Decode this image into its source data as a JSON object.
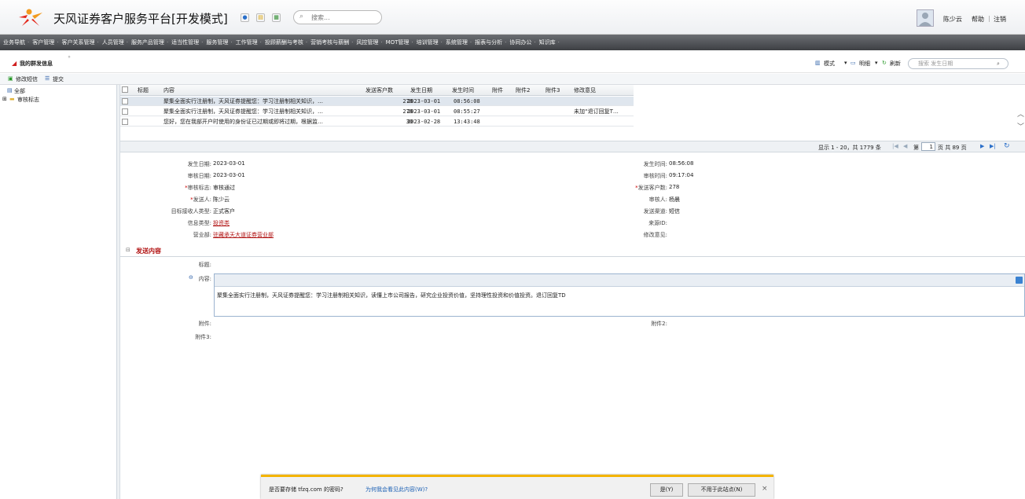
{
  "header": {
    "title": "天风证券客户服务平台[开发模式]",
    "search_placeholder": "搜索...",
    "user_name": "陈少云",
    "help": "帮助",
    "logout": "注销"
  },
  "menu": [
    "业务导航",
    "客户管理",
    "客户关系管理",
    "人员管理",
    "服务产品管理",
    "适当性管理",
    "服务管理",
    "工作管理",
    "投顾薪酬与考核",
    "营销考核与薪酬",
    "风控管理",
    "MOT管理",
    "培训管理",
    "系统管理",
    "报表与分析",
    "协同办公",
    "知识库"
  ],
  "page_tab": "我的群发信息",
  "toolbar": {
    "edit_sms": "修改短信",
    "submit": "提交",
    "mode": "模式",
    "detail": "明细",
    "refresh": "刷新",
    "search_placeholder": "搜索 发生日期"
  },
  "tree": {
    "all": "全部",
    "audit_flag": "审核标志"
  },
  "grid": {
    "headers": [
      "标题",
      "内容",
      "发送客户数",
      "发生日期",
      "发生时间",
      "附件",
      "附件2",
      "附件3",
      "修改意见"
    ],
    "rows": [
      {
        "content": "聚集全面实行注册制，天风证券提醒您：学习注册制相关知识，…",
        "count": "278",
        "date": "2023-03-01",
        "time": "08:56:08",
        "remark": ""
      },
      {
        "content": "聚集全面实行注册制，天风证券提醒您：学习注册制相关知识，…",
        "count": "278",
        "date": "2023-03-01",
        "time": "08:55:27",
        "remark": "未加“退订回复T…"
      },
      {
        "content": "您好，您在我部开户时使用的身份证已过期或即将过期，根据监…",
        "count": "30",
        "date": "2023-02-28",
        "time": "13:43:48",
        "remark": ""
      }
    ]
  },
  "pager": {
    "summary": "显示 1 - 20，共 1779 条",
    "page_prefix": "第",
    "page_num": "1",
    "page_suffix": "页 共 89 页"
  },
  "details": {
    "left": [
      {
        "label": "发生日期:",
        "value": "2023-03-01",
        "required": false
      },
      {
        "label": "审核日期:",
        "value": "2023-03-01",
        "required": false
      },
      {
        "label": "审核标志:",
        "value": "审核通过",
        "required": true
      },
      {
        "label": "发送人:",
        "value": "陈少云",
        "required": true
      },
      {
        "label": "目标接收人类型:",
        "value": "正式客户",
        "required": false
      },
      {
        "label": "信息类型:",
        "value": "投资类",
        "required": false,
        "link": true
      },
      {
        "label": "营业部:",
        "value": "驻藏承天大道证券营业部",
        "required": false,
        "link": true
      }
    ],
    "right": [
      {
        "label": "发生时间:",
        "value": "08:56:08"
      },
      {
        "label": "审核时间:",
        "value": "09:17:04"
      },
      {
        "label": "发送客户数:",
        "value": "278",
        "required": true
      },
      {
        "label": "审核人:",
        "value": "杨晨"
      },
      {
        "label": "发送渠道:",
        "value": "短信"
      },
      {
        "label": "来源ID:",
        "value": ""
      },
      {
        "label": "修改意见:",
        "value": ""
      }
    ],
    "section_title": "发送内容",
    "title_label": "标题:",
    "content_label": "内容:",
    "content_text": "聚集全面实行注册制，天风证券提醒您：学习注册制相关知识，读懂上市公司报告，研究企业投资价值，坚持理性投资和价值投资。退订回复TD",
    "attach_label": "附件:",
    "attach2_label": "附件2:",
    "attach3_label": "附件3:"
  },
  "password_bar": {
    "question": "是否要存储 tfzq.com 的密码?",
    "why_link": "为何我会看见此内容(W)?",
    "yes": "是(Y)",
    "never": "不用于此站点(N)",
    "close": "×"
  }
}
